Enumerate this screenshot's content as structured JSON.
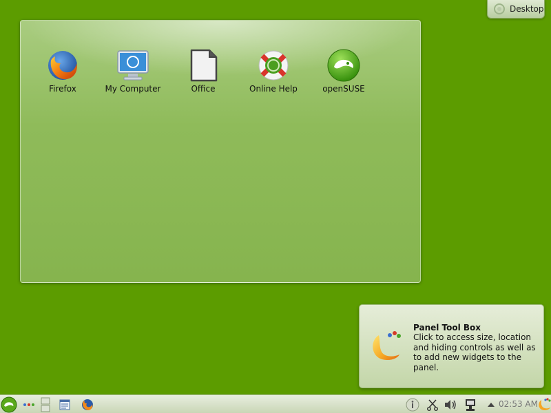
{
  "desktop_button": {
    "label": "Desktop",
    "icon": "cashew-icon"
  },
  "folderview": {
    "icons": [
      {
        "label": "Firefox",
        "icon": "firefox-icon"
      },
      {
        "label": "My Computer",
        "icon": "computer-icon"
      },
      {
        "label": "Office",
        "icon": "office-document-icon"
      },
      {
        "label": "Online Help",
        "icon": "help-lifebuoy-icon"
      },
      {
        "label": "openSUSE",
        "icon": "opensuse-icon"
      }
    ]
  },
  "tooltip": {
    "title": "Panel Tool Box",
    "body": "Click to access size, location and hiding controls as well as to add new widgets to the panel."
  },
  "panel": {
    "clock": "02:53 AM",
    "items": [
      "kickoff-menu-icon",
      "activity-dots-icon",
      "pager-icon",
      "task-manager-icon",
      "firefox-launcher-icon",
      "info-icon",
      "klipper-scissors-icon",
      "volume-icon",
      "network-icon",
      "tray-expand-icon",
      "panel-toolbox-icon"
    ]
  },
  "colors": {
    "desktop_bg": "#5c9c00",
    "accent": "#73ba25"
  }
}
